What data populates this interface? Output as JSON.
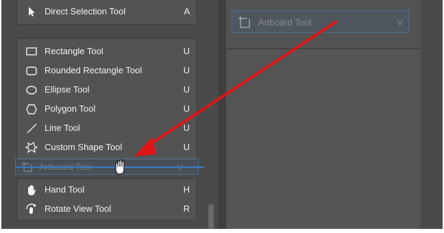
{
  "tools_group_1": [
    {
      "label": "Direct Selection Tool",
      "key": "A",
      "icon": "direct-selection-arrow-icon"
    }
  ],
  "tools_group_2": [
    {
      "label": "Rectangle Tool",
      "key": "U",
      "icon": "rectangle-icon"
    },
    {
      "label": "Rounded Rectangle Tool",
      "key": "U",
      "icon": "rounded-rectangle-icon"
    },
    {
      "label": "Ellipse Tool",
      "key": "U",
      "icon": "ellipse-icon"
    },
    {
      "label": "Polygon Tool",
      "key": "U",
      "icon": "polygon-icon"
    },
    {
      "label": "Line Tool",
      "key": "U",
      "icon": "line-icon"
    },
    {
      "label": "Custom Shape Tool",
      "key": "U",
      "icon": "custom-shape-icon"
    }
  ],
  "dragged_tool": {
    "label": "Artboard Tool",
    "key": "V",
    "icon": "artboard-icon"
  },
  "tools_group_3": [
    {
      "label": "Hand Tool",
      "key": "H",
      "icon": "hand-icon"
    },
    {
      "label": "Rotate View Tool",
      "key": "R",
      "icon": "rotate-view-icon"
    }
  ],
  "right_slot": {
    "label": "Artboard Tool",
    "key": "V",
    "icon": "artboard-icon"
  },
  "colors": {
    "panel_bg": "#535353",
    "frame_bg": "#4a4a4a",
    "text": "#f2f2f2",
    "highlight_border": "#4f6f96",
    "drop_line": "#3d78c8",
    "annotation_arrow": "#e01414"
  }
}
